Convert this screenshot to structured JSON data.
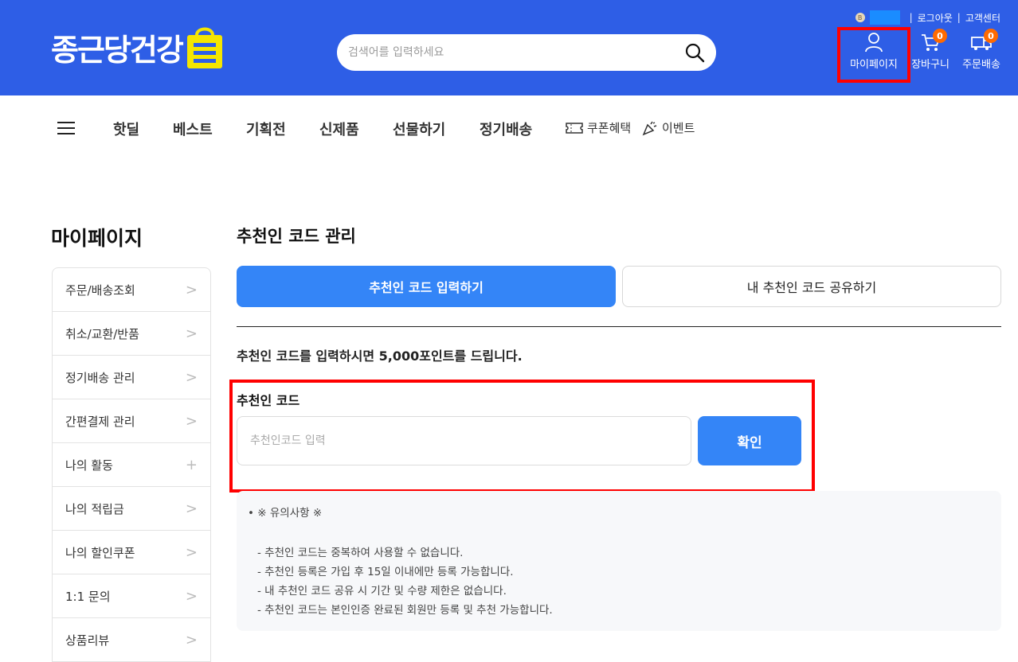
{
  "header": {
    "logo_text": "종근당건강",
    "search_placeholder": "검색어를 입력하세요",
    "util": {
      "logout": "로그아웃",
      "support": "고객센터",
      "sep": "|",
      "dot": "B"
    },
    "icons": {
      "mypage": "마이페이지",
      "cart": "장바구니",
      "cart_count": "0",
      "delivery": "주문배송",
      "delivery_count": "0"
    },
    "colors": {
      "brand": "#2e5ee6",
      "badge": "#ff6a00"
    }
  },
  "gnb": {
    "items": [
      "핫딜",
      "베스트",
      "기획전",
      "신제품",
      "선물하기",
      "정기배송"
    ],
    "coupon": "쿠폰혜택",
    "event": "이벤트"
  },
  "sidebar": {
    "title": "마이페이지",
    "items": [
      {
        "label": "주문/배송조회",
        "icon": ">"
      },
      {
        "label": "취소/교환/반품",
        "icon": ">"
      },
      {
        "label": "정기배송 관리",
        "icon": ">"
      },
      {
        "label": "간편결제 관리",
        "icon": ">"
      },
      {
        "label": "나의 활동",
        "icon": "+"
      },
      {
        "label": "나의 적립금",
        "icon": ">"
      },
      {
        "label": "나의 할인쿠폰",
        "icon": ">"
      },
      {
        "label": "1:1 문의",
        "icon": ">"
      },
      {
        "label": "상품리뷰",
        "icon": ">"
      }
    ]
  },
  "main": {
    "title": "추천인 코드 관리",
    "tabs": [
      {
        "label": "추천인 코드 입력하기"
      },
      {
        "label": "내 추천인 코드 공유하기"
      }
    ],
    "notice": "추천인 코드를 입력하시면 5,000포인트를 드립니다.",
    "code_label": "추천인 코드",
    "code_placeholder": "추천인코드 입력",
    "confirm": "확인",
    "guide_title": "• ※ 유의사항 ※",
    "guide_lines": [
      "- 추천인 코드는 중복하여 사용할 수 없습니다.",
      "- 추천인 등록은 가입 후 15일 이내에만 등록 가능합니다.",
      "- 내 추천인 코드 공유 시 기간 및 수량 제한은 없습니다.",
      "- 추천인 코드는 본인인증 완료된 회원만 등록 및 추천 가능합니다."
    ],
    "colors": {
      "accent": "#3485f7"
    }
  }
}
